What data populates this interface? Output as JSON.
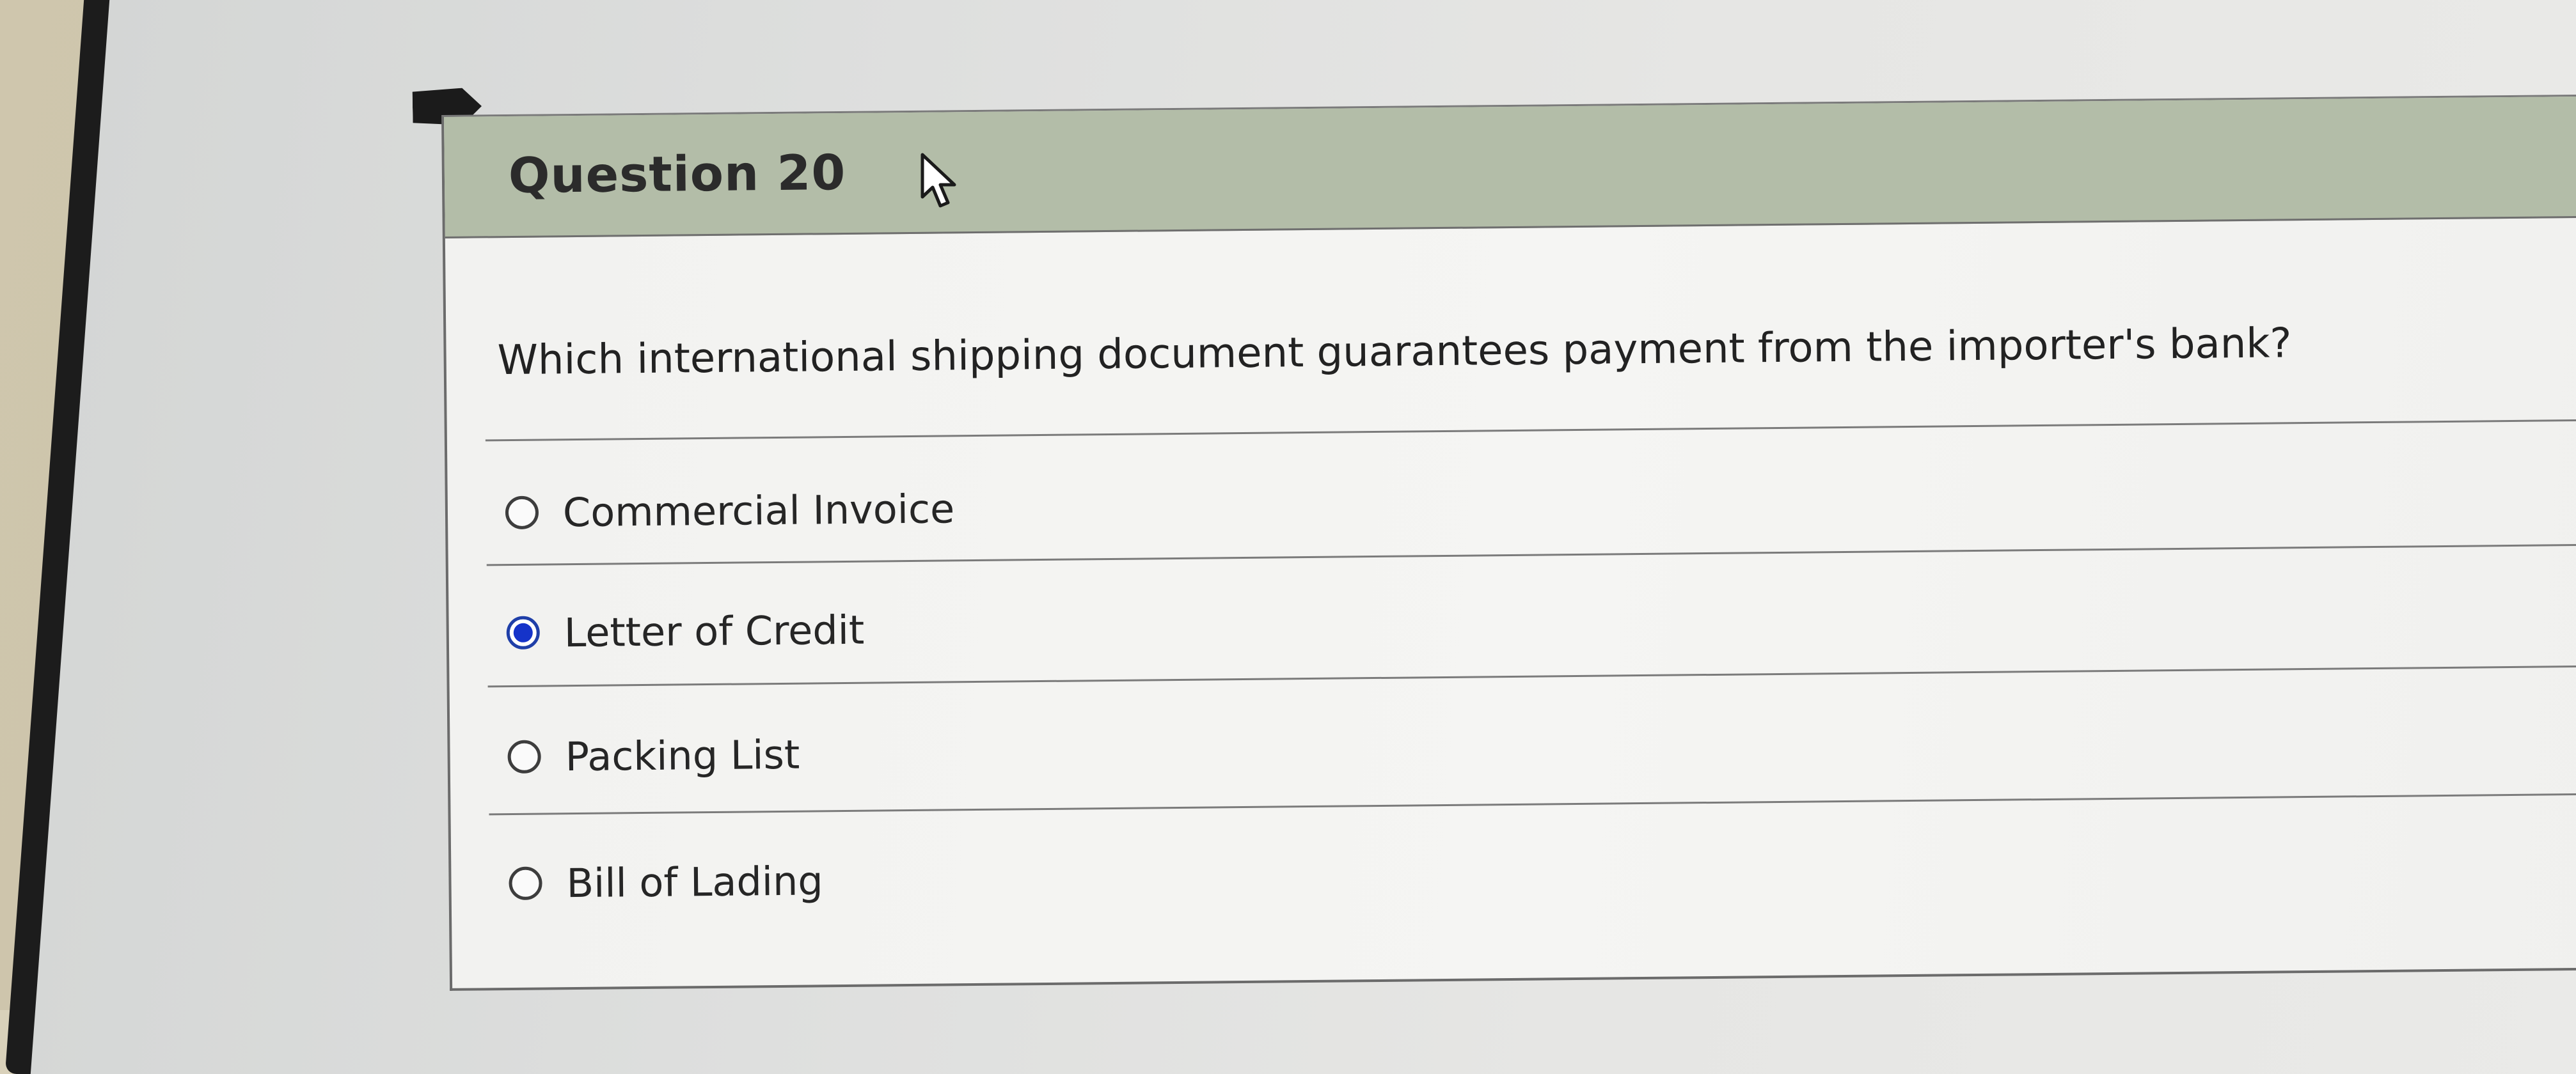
{
  "question": {
    "title": "Question 20",
    "prompt": "Which international shipping document guarantees payment from the importer's bank?",
    "selected_index": 1,
    "options": [
      {
        "label": "Commercial Invoice",
        "selected": false
      },
      {
        "label": "Letter of Credit",
        "selected": true
      },
      {
        "label": "Packing List",
        "selected": false
      },
      {
        "label": "Bill of Lading",
        "selected": false
      }
    ]
  },
  "icons": {
    "marker": "flag-marker-icon",
    "cursor": "mouse-pointer-icon",
    "radio": "radio-button-icon"
  },
  "colors": {
    "header_bg": "#b3bda8",
    "panel_bg": "#f4f4f2",
    "radio_selected": "#1533c9",
    "text": "#262626"
  }
}
